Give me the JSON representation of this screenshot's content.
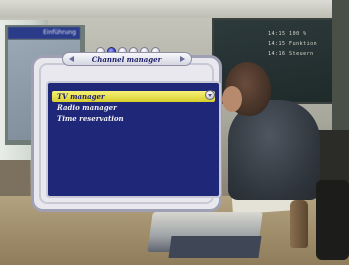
{
  "osd": {
    "title": "Channel manager",
    "page_dots": 6,
    "active_dot": 1,
    "menu_items": [
      {
        "label": "TV manager",
        "selected": true
      },
      {
        "label": "Radio manager",
        "selected": false
      },
      {
        "label": "Time reservation",
        "selected": false
      }
    ]
  },
  "background_screen": {
    "tag": "Einführung",
    "lines": [
      "14:15 100 %",
      "14:15 Funktion",
      "14:16 Steuern"
    ]
  },
  "colors": {
    "menu_background": "#1f2778",
    "selection_highlight": "#e6de3c",
    "panel": "#e8e8ee"
  },
  "icons": [
    "scroll-arrow-icon",
    "title-left-arrow-icon",
    "title-right-arrow-icon"
  ]
}
